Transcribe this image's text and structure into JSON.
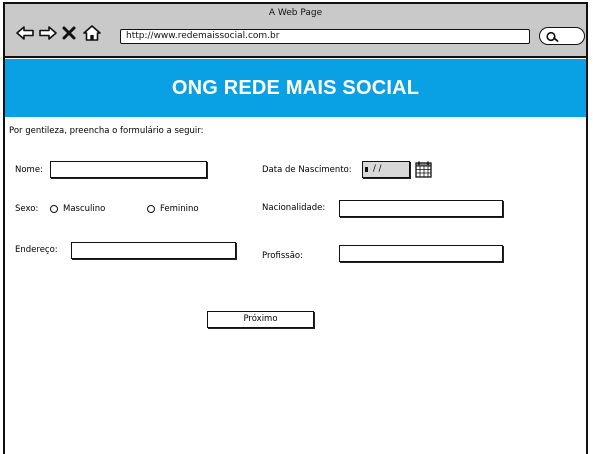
{
  "window": {
    "title": "A Web Page",
    "url": "http://www.redemaissocial.com.br"
  },
  "banner": {
    "title": "ONG REDE MAIS SOCIAL",
    "color": "#0aa0e4"
  },
  "form": {
    "intro": "Por gentileza, preencha o formulário a seguir:",
    "name_label": "Nome:",
    "birth_label": "Data de Nascimento:",
    "birth_placeholder": "/ /",
    "sex_label": "Sexo:",
    "sex_options": [
      "Masculino",
      "Feminino"
    ],
    "nationality_label": "Nacionalidade:",
    "address_label": "Endereço:",
    "profession_label": "Profissão:",
    "next_button": "Próximo"
  },
  "icons": [
    "back-arrow-icon",
    "forward-arrow-icon",
    "close-icon",
    "home-icon",
    "search-icon",
    "calendar-icon"
  ]
}
